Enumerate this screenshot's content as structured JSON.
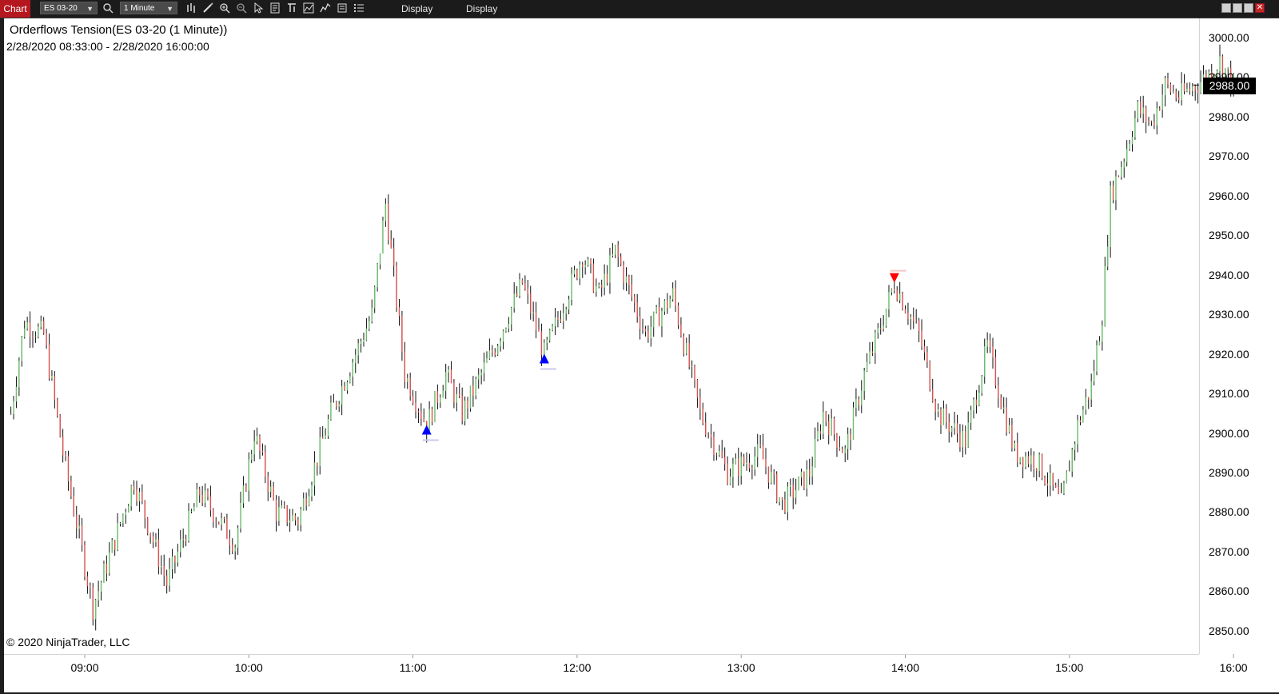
{
  "toolbar": {
    "tab_label": "Chart",
    "instrument": "ES 03-20",
    "interval": "1 Minute",
    "display1": "Display",
    "display2": "Display",
    "icons": [
      "bars-type-icon",
      "draw-pencil-icon",
      "zoom-in-icon",
      "zoom-out-icon",
      "pointer-icon",
      "properties-icon",
      "strategies-icon",
      "indicators-icon",
      "templates-icon",
      "data-box-icon",
      "list-icon"
    ]
  },
  "chart": {
    "title": "Orderflows Tension(ES 03-20 (1 Minute))",
    "range": "2/28/2020 08:33:00 - 2/28/2020 16:00:00",
    "copyright": "© 2020 NinjaTrader, LLC",
    "last_price": "2988.00",
    "price_ticks": [
      "3000.00",
      "2990.00",
      "2980.00",
      "2970.00",
      "2960.00",
      "2950.00",
      "2940.00",
      "2930.00",
      "2920.00",
      "2910.00",
      "2900.00",
      "2890.00",
      "2880.00",
      "2870.00",
      "2860.00",
      "2850.00"
    ],
    "time_ticks": [
      "09:00",
      "10:00",
      "11:00",
      "12:00",
      "13:00",
      "14:00",
      "15:00",
      "16:00"
    ],
    "colors": {
      "up": "#6cbf6c",
      "down": "#d9534f",
      "buy_signal": "#0000ff",
      "sell_signal": "#ff0000"
    }
  },
  "chart_data": {
    "type": "ohlc",
    "instrument": "ES 03-20",
    "interval_minutes": 1,
    "ylim": [
      2846,
      3005
    ],
    "xlim": [
      "08:33",
      "16:00"
    ],
    "key_points": [
      {
        "time": "08:33",
        "price": 2905
      },
      {
        "time": "08:38",
        "price": 2928
      },
      {
        "time": "08:45",
        "price": 2925
      },
      {
        "time": "08:52",
        "price": 2895
      },
      {
        "time": "09:03",
        "price": 2856
      },
      {
        "time": "09:18",
        "price": 2888
      },
      {
        "time": "09:30",
        "price": 2862
      },
      {
        "time": "09:42",
        "price": 2885
      },
      {
        "time": "09:55",
        "price": 2872
      },
      {
        "time": "10:02",
        "price": 2900
      },
      {
        "time": "10:10",
        "price": 2880
      },
      {
        "time": "10:18",
        "price": 2878
      },
      {
        "time": "10:30",
        "price": 2905
      },
      {
        "time": "10:45",
        "price": 2930
      },
      {
        "time": "10:50",
        "price": 2958
      },
      {
        "time": "10:57",
        "price": 2915
      },
      {
        "time": "11:05",
        "price": 2902
      },
      {
        "time": "11:12",
        "price": 2915
      },
      {
        "time": "11:18",
        "price": 2905
      },
      {
        "time": "11:30",
        "price": 2922
      },
      {
        "time": "11:40",
        "price": 2938
      },
      {
        "time": "11:48",
        "price": 2920
      },
      {
        "time": "12:02",
        "price": 2945
      },
      {
        "time": "12:08",
        "price": 2935
      },
      {
        "time": "12:14",
        "price": 2946
      },
      {
        "time": "12:25",
        "price": 2925
      },
      {
        "time": "12:35",
        "price": 2935
      },
      {
        "time": "12:45",
        "price": 2905
      },
      {
        "time": "12:55",
        "price": 2890
      },
      {
        "time": "13:07",
        "price": 2895
      },
      {
        "time": "13:15",
        "price": 2882
      },
      {
        "time": "13:25",
        "price": 2890
      },
      {
        "time": "13:30",
        "price": 2905
      },
      {
        "time": "13:38",
        "price": 2895
      },
      {
        "time": "13:45",
        "price": 2915
      },
      {
        "time": "13:50",
        "price": 2925
      },
      {
        "time": "13:56",
        "price": 2938
      },
      {
        "time": "14:05",
        "price": 2925
      },
      {
        "time": "14:12",
        "price": 2905
      },
      {
        "time": "14:22",
        "price": 2898
      },
      {
        "time": "14:30",
        "price": 2922
      },
      {
        "time": "14:40",
        "price": 2895
      },
      {
        "time": "14:48",
        "price": 2893
      },
      {
        "time": "14:57",
        "price": 2882
      },
      {
        "time": "15:03",
        "price": 2902
      },
      {
        "time": "15:08",
        "price": 2912
      },
      {
        "time": "15:12",
        "price": 2930
      },
      {
        "time": "15:15",
        "price": 2960
      },
      {
        "time": "15:20",
        "price": 2970
      },
      {
        "time": "15:25",
        "price": 2982
      },
      {
        "time": "15:30",
        "price": 2978
      },
      {
        "time": "15:35",
        "price": 2988
      },
      {
        "time": "15:40",
        "price": 2985
      },
      {
        "time": "15:50",
        "price": 2990
      },
      {
        "time": "15:55",
        "price": 2994
      },
      {
        "time": "16:00",
        "price": 2988
      }
    ],
    "signals": [
      {
        "type": "buy",
        "time": "11:05",
        "price": 2901
      },
      {
        "type": "buy",
        "time": "11:48",
        "price": 2919
      },
      {
        "type": "sell",
        "time": "13:56",
        "price": 2939
      }
    ]
  }
}
